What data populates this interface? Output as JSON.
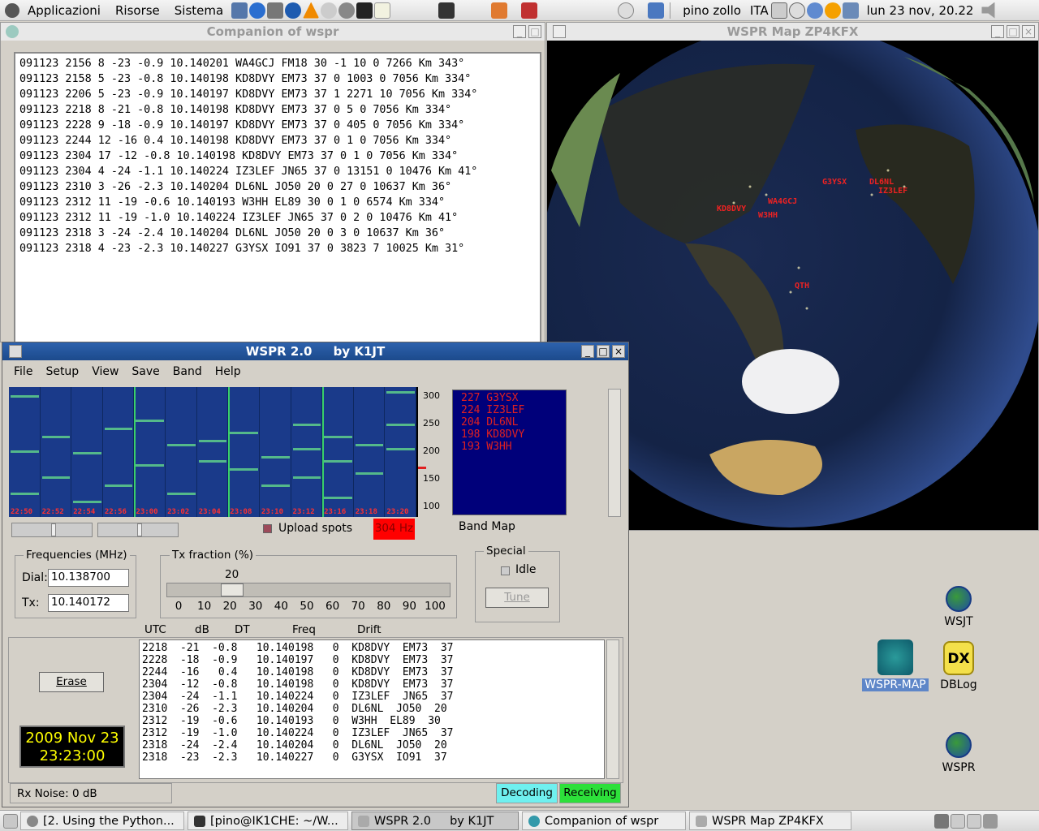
{
  "top_panel": {
    "menus": [
      "Applicazioni",
      "Risorse",
      "Sistema"
    ],
    "user": "pino zollo",
    "keyboard": "ITA",
    "clock": "lun 23 nov, 20.22"
  },
  "companion": {
    "title": "Companion of wspr",
    "lines": [
      "091123 2156 8 -23 -0.9 10.140201 WA4GCJ FM18 30 -1 10 0 7266 Km 343°",
      "091123 2158 5 -23 -0.8 10.140198 KD8DVY EM73 37 0 1003 0 7056 Km 334°",
      "091123 2206 5 -23 -0.9 10.140197 KD8DVY EM73 37 1 2271 10 7056 Km 334°",
      "091123 2218 8 -21 -0.8 10.140198 KD8DVY EM73 37 0 5 0 7056 Km 334°",
      "091123 2228 9 -18 -0.9 10.140197 KD8DVY EM73 37 0 405 0 7056 Km 334°",
      "091123 2244 12 -16 0.4 10.140198 KD8DVY EM73 37 0 1 0 7056 Km 334°",
      "091123 2304 17 -12 -0.8 10.140198 KD8DVY EM73 37 0 1 0 7056 Km 334°",
      "091123 2304 4 -24 -1.1 10.140224 IZ3LEF JN65 37 0 13151 0 10476 Km 41°",
      "091123 2310 3 -26 -2.3 10.140204 DL6NL JO50 20 0 27 0 10637 Km 36°",
      "091123 2312 11 -19 -0.6 10.140193 W3HH EL89 30 0 1 0 6574 Km 334°",
      "091123 2312 11 -19 -1.0 10.140224 IZ3LEF JN65 37 0 2 0 10476 Km 41°",
      "091123 2318 3 -24 -2.4 10.140204 DL6NL JO50 20 0 3 0 10637 Km 36°",
      "091123 2318 4 -23 -2.3 10.140227 G3YSX IO91 37 0 3823 7 10025 Km 31°"
    ]
  },
  "map": {
    "title": "WSPR Map ZP4KFX",
    "labels": [
      "G3YSX",
      "DL6NL",
      "IZ3LEF",
      "WA4GCJ",
      "KD8DVY",
      "W3HH",
      "QTH"
    ]
  },
  "wspr": {
    "title": "WSPR 2.0     by K1JT",
    "menu": [
      "File",
      "Setup",
      "View",
      "Save",
      "Band",
      "Help"
    ],
    "waterfall_times": [
      "22:50",
      "22:52",
      "22:54",
      "22:56",
      "23:00",
      "23:02",
      "23:04",
      "23:08",
      "23:10",
      "23:12",
      "23:16",
      "23:18",
      "23:20"
    ],
    "scale_ticks": [
      "300",
      "250",
      "200",
      "150",
      "100"
    ],
    "band_map": [
      "227 G3YSX",
      "224 IZ3LEF",
      "204 DL6NL",
      "198 KD8DVY",
      "193 W3HH"
    ],
    "band_map_label": "Band Map",
    "upload_spots": "Upload spots",
    "hz_label": "304 Hz",
    "frequencies_label": "Frequencies (MHz)",
    "dial_label": "Dial:",
    "dial_value": "10.138700",
    "tx_label": "Tx:",
    "tx_value": "10.140172",
    "tx_fraction_label": "Tx fraction (%)",
    "tx_fraction_value": "20",
    "tx_fraction_ticks": [
      "0",
      "10",
      "20",
      "30",
      "40",
      "50",
      "60",
      "70",
      "80",
      "90",
      "100"
    ],
    "special_label": "Special",
    "idle_label": "Idle",
    "tune_label": "Tune",
    "headers": [
      "UTC",
      "dB",
      "DT",
      "Freq",
      "Drift"
    ],
    "erase_label": "Erase",
    "date": "2009 Nov 23",
    "time": "23:23:00",
    "decodes": [
      "2218  -21  -0.8   10.140198   0  KD8DVY  EM73  37",
      "2228  -18  -0.9   10.140197   0  KD8DVY  EM73  37",
      "2244  -16   0.4   10.140198   0  KD8DVY  EM73  37",
      "2304  -12  -0.8   10.140198   0  KD8DVY  EM73  37",
      "2304  -24  -1.1   10.140224   0  IZ3LEF  JN65  37",
      "2310  -26  -2.3   10.140204   0  DL6NL  JO50  20",
      "2312  -19  -0.6   10.140193   0  W3HH  EL89  30",
      "2312  -19  -1.0   10.140224   0  IZ3LEF  JN65  37",
      "2318  -24  -2.4   10.140204   0  DL6NL  JO50  20",
      "2318  -23  -2.3   10.140227   0  G3YSX  IO91  37"
    ],
    "rx_noise": "Rx Noise: 0 dB",
    "decoding": "Decoding",
    "receiving": "Receiving"
  },
  "desktop_icons": [
    "WSJT",
    "WSPR-MAP",
    "DBLog",
    "WSPR"
  ],
  "dblog_glyph": "DX",
  "taskbar": {
    "tasks": [
      "[2. Using the Python...",
      "[pino@IK1CHE: ~/W...",
      "WSPR 2.0     by K1JT",
      "Companion of wspr",
      "WSPR Map ZP4KFX"
    ]
  }
}
